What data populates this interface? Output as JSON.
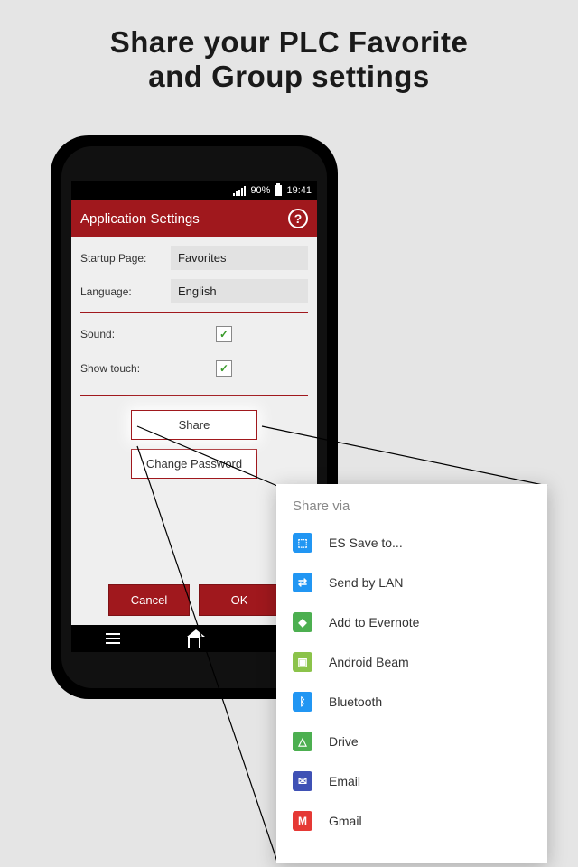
{
  "headline_l1": "Share your PLC Favorite",
  "headline_l2": "and Group settings",
  "status": {
    "battery_pct": "90%",
    "time": "19:41"
  },
  "appbar": {
    "title": "Application Settings"
  },
  "settings": {
    "startup_label": "Startup Page:",
    "startup_value": "Favorites",
    "language_label": "Language:",
    "language_value": "English",
    "sound_label": "Sound:",
    "touch_label": "Show touch:"
  },
  "buttons": {
    "share": "Share",
    "change_pw": "Change Password",
    "cancel": "Cancel",
    "ok": "OK"
  },
  "share_sheet": {
    "title": "Share via",
    "items": [
      {
        "label": "ES Save to..."
      },
      {
        "label": "Send by LAN"
      },
      {
        "label": "Add to Evernote"
      },
      {
        "label": "Android Beam"
      },
      {
        "label": "Bluetooth"
      },
      {
        "label": "Drive"
      },
      {
        "label": "Email"
      },
      {
        "label": "Gmail"
      }
    ]
  }
}
